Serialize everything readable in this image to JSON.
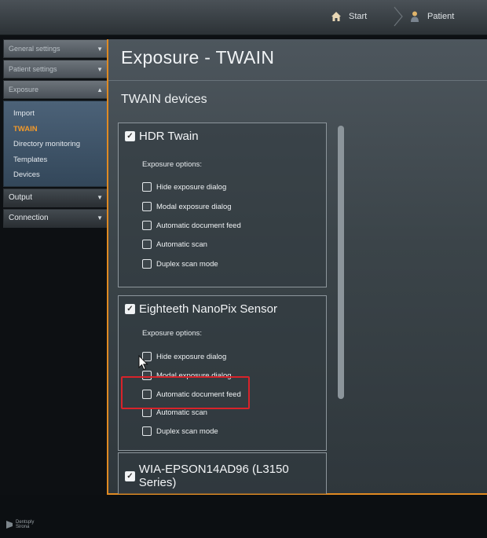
{
  "topbar": {
    "start_label": "Start",
    "patient_label": "Patient",
    "start_icon": "home-icon",
    "patient_icon": "patient-icon"
  },
  "sidebar": {
    "sections": [
      {
        "label": "General settings",
        "expanded": false
      },
      {
        "label": "Patient settings",
        "expanded": false
      },
      {
        "label": "Exposure",
        "expanded": true
      }
    ],
    "exposure_items": [
      {
        "label": "Import",
        "active": false
      },
      {
        "label": "TWAIN",
        "active": true
      },
      {
        "label": "Directory monitoring",
        "active": false
      },
      {
        "label": "Templates",
        "active": false
      },
      {
        "label": "Devices",
        "active": false
      }
    ],
    "bottom_sections": [
      {
        "label": "Output",
        "expanded": false
      },
      {
        "label": "Connection",
        "expanded": false
      }
    ]
  },
  "main": {
    "title": "Exposure  -  TWAIN",
    "section_title": "TWAIN devices",
    "devices": [
      {
        "name": "HDR Twain",
        "enabled": true,
        "options_label": "Exposure options:",
        "options": [
          {
            "label": "Hide exposure dialog",
            "checked": false
          },
          {
            "label": "Modal exposure dialog",
            "checked": false
          },
          {
            "label": "Automatic document feed",
            "checked": false
          },
          {
            "label": "Automatic scan",
            "checked": false
          },
          {
            "label": "Duplex scan mode",
            "checked": false
          }
        ]
      },
      {
        "name": "Eighteeth NanoPix Sensor",
        "enabled": true,
        "options_label": "Exposure options:",
        "options": [
          {
            "label": "Hide exposure dialog",
            "checked": false
          },
          {
            "label": "Modal exposure dialog",
            "checked": false
          },
          {
            "label": "Automatic document feed",
            "checked": false
          },
          {
            "label": "Automatic scan",
            "checked": false
          },
          {
            "label": "Duplex scan mode",
            "checked": false
          }
        ]
      },
      {
        "name": "WIA-EPSON14AD96 (L3150 Series)",
        "enabled": true
      }
    ]
  },
  "footer": {
    "logo_line1": "Dentsply",
    "logo_line2": "Sirona"
  },
  "colors": {
    "accent": "#e08a22",
    "active_item": "#f39a2a",
    "highlight": "#d8232a"
  }
}
